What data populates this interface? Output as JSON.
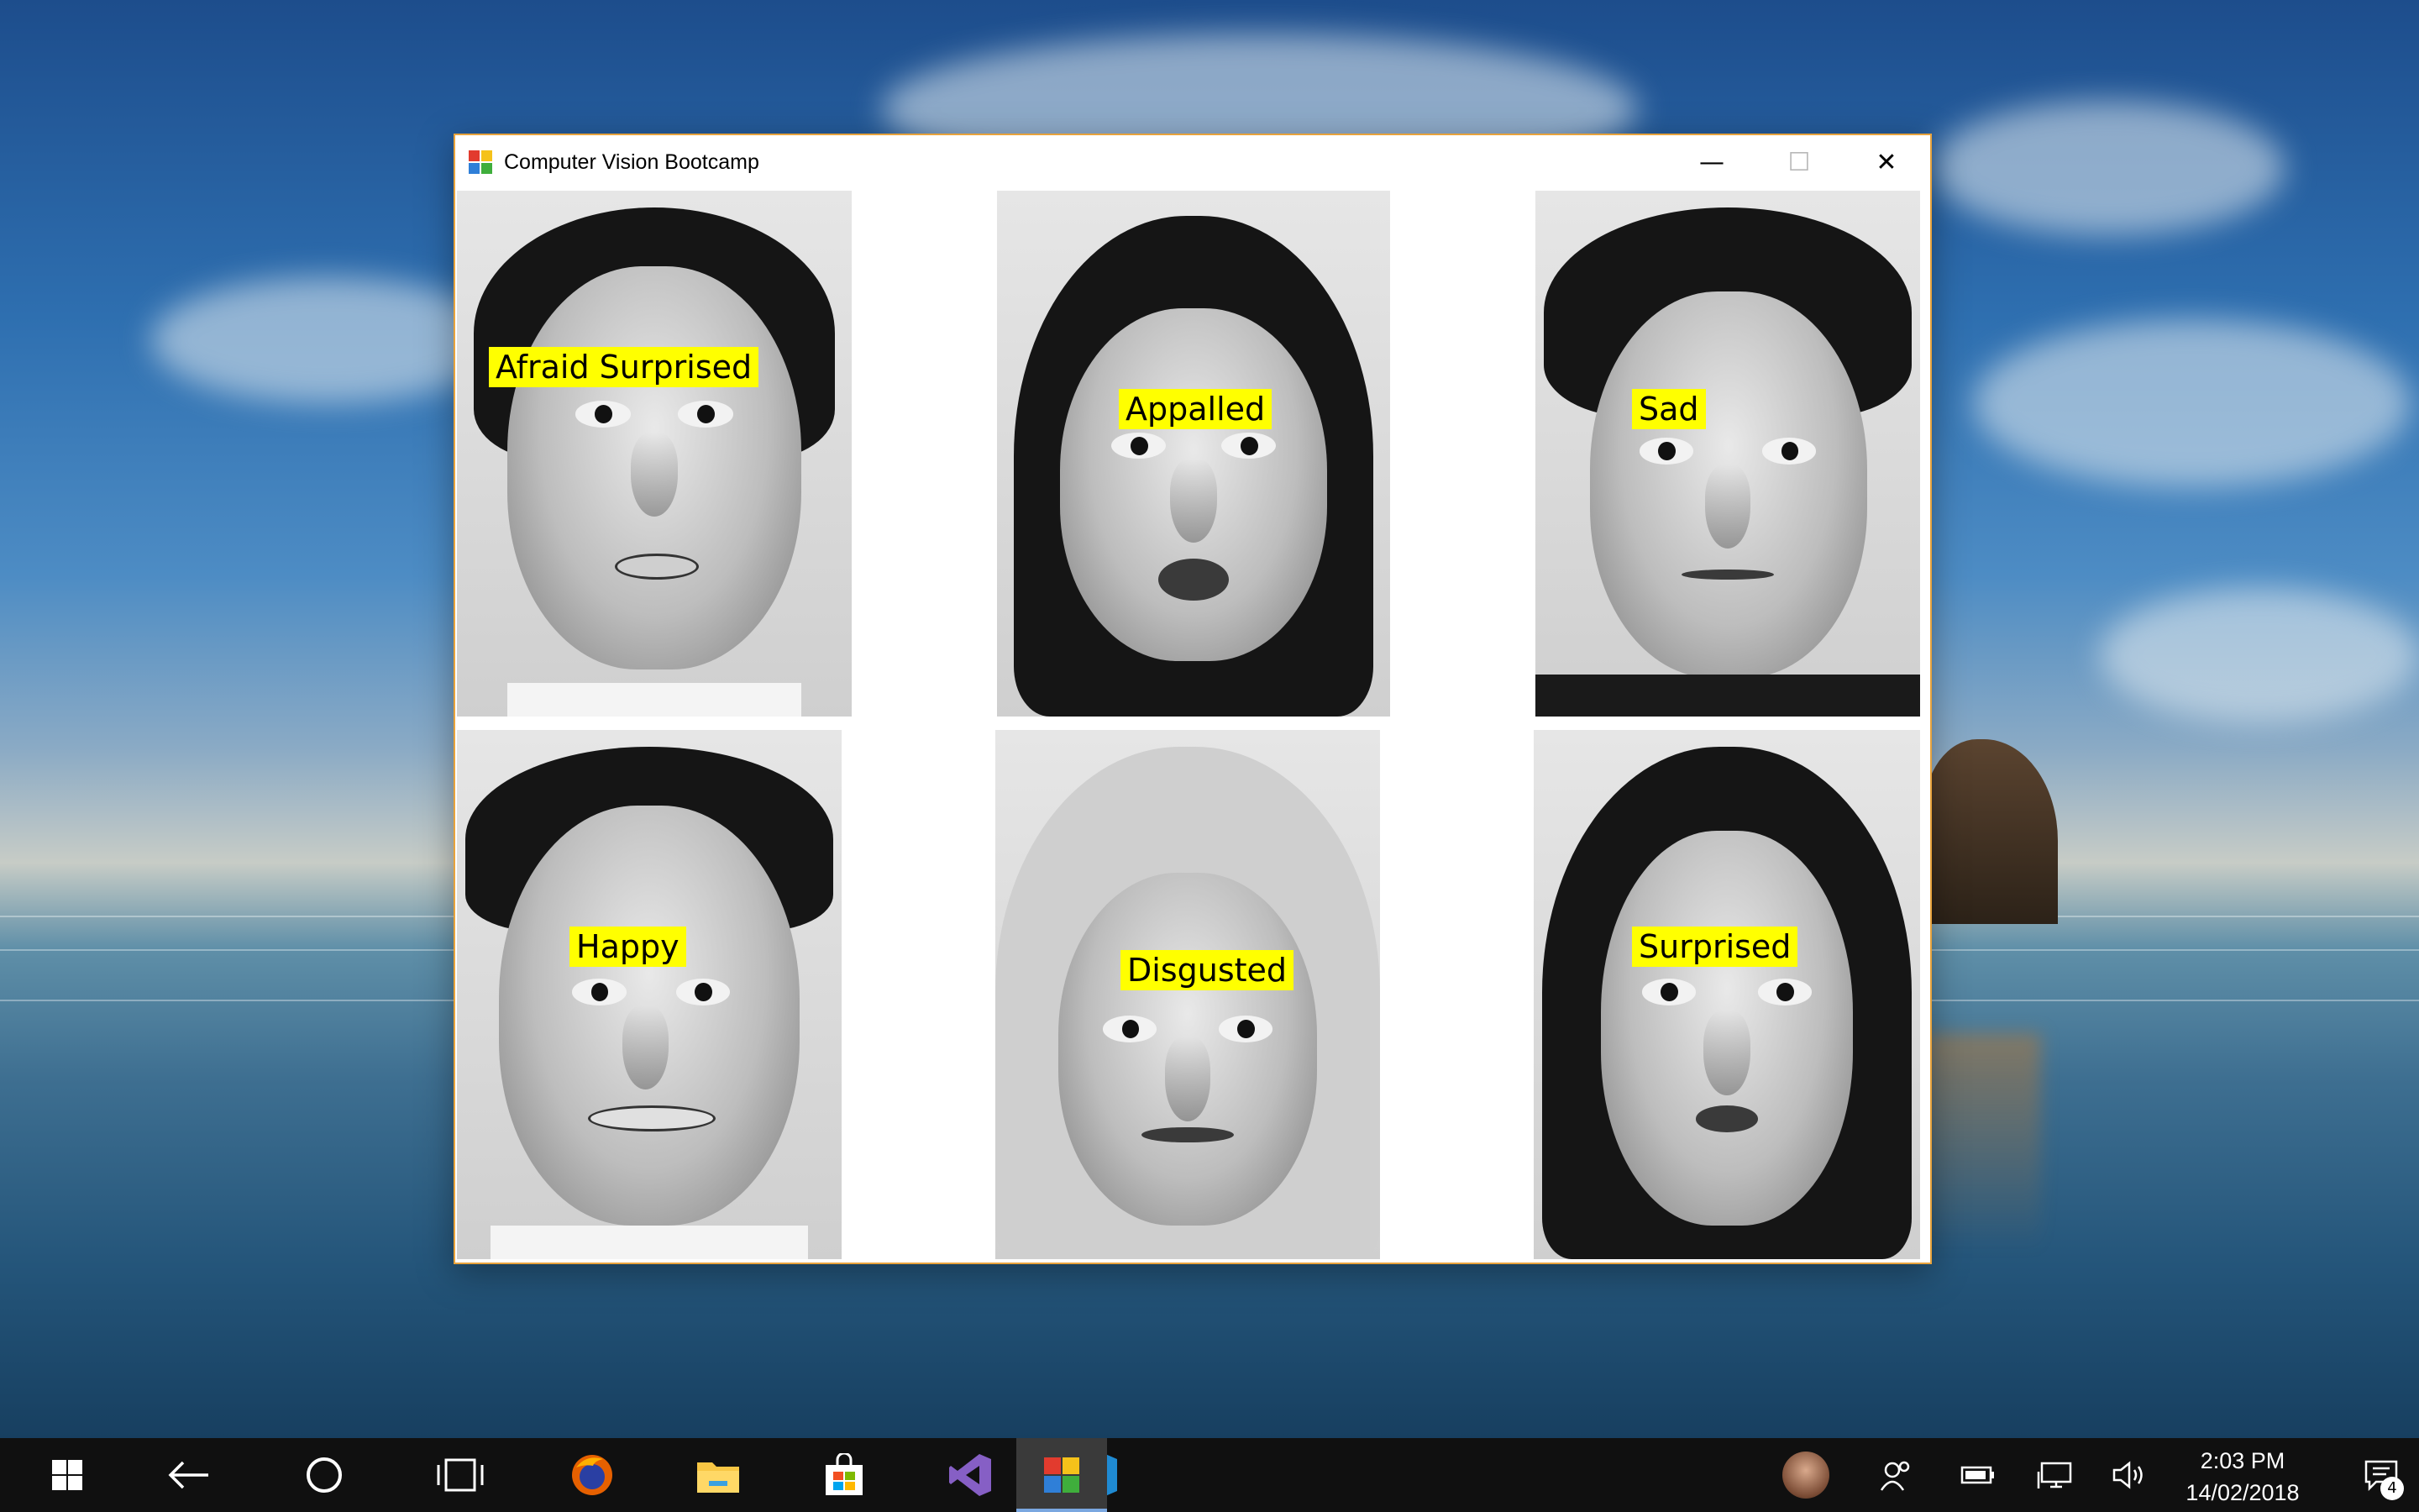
{
  "window": {
    "title": "Computer Vision Bootcamp",
    "controls": {
      "minimize": "—",
      "maximize": "☐",
      "close": "✕"
    }
  },
  "faces": [
    {
      "label": "Afraid Surprised"
    },
    {
      "label": "Appalled"
    },
    {
      "label": "Sad"
    },
    {
      "label": "Happy"
    },
    {
      "label": "Disgusted"
    },
    {
      "label": "Surprised"
    }
  ],
  "taskbar": {
    "pinned": [
      "start-icon",
      "back-icon",
      "cortana-icon",
      "task-view-icon",
      "firefox-icon",
      "file-explorer-icon",
      "store-icon",
      "visual-studio-icon",
      "vs-code-icon",
      "app-icon"
    ],
    "time": "2:03 PM",
    "date": "14/02/2018",
    "notifications_count": "4"
  },
  "colors": {
    "label_bg": "#ffff00",
    "window_border": "#e8a33c",
    "taskbar_bg": "#101010"
  }
}
